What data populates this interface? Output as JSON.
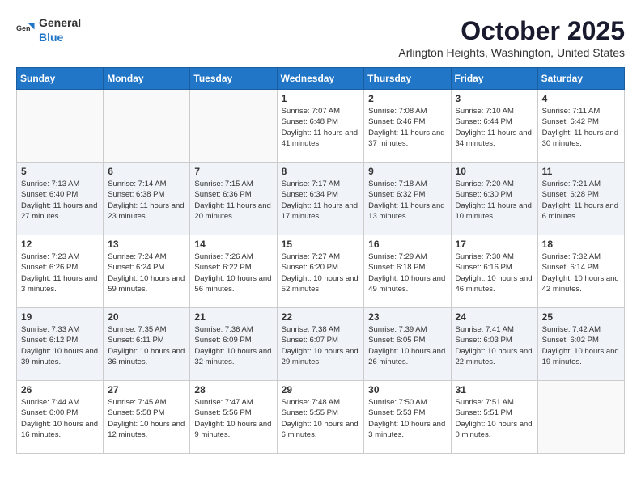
{
  "header": {
    "logo_general": "General",
    "logo_blue": "Blue",
    "month_title": "October 2025",
    "location": "Arlington Heights, Washington, United States"
  },
  "weekdays": [
    "Sunday",
    "Monday",
    "Tuesday",
    "Wednesday",
    "Thursday",
    "Friday",
    "Saturday"
  ],
  "weeks": [
    [
      {
        "day": "",
        "info": ""
      },
      {
        "day": "",
        "info": ""
      },
      {
        "day": "",
        "info": ""
      },
      {
        "day": "1",
        "info": "Sunrise: 7:07 AM\nSunset: 6:48 PM\nDaylight: 11 hours and 41 minutes."
      },
      {
        "day": "2",
        "info": "Sunrise: 7:08 AM\nSunset: 6:46 PM\nDaylight: 11 hours and 37 minutes."
      },
      {
        "day": "3",
        "info": "Sunrise: 7:10 AM\nSunset: 6:44 PM\nDaylight: 11 hours and 34 minutes."
      },
      {
        "day": "4",
        "info": "Sunrise: 7:11 AM\nSunset: 6:42 PM\nDaylight: 11 hours and 30 minutes."
      }
    ],
    [
      {
        "day": "5",
        "info": "Sunrise: 7:13 AM\nSunset: 6:40 PM\nDaylight: 11 hours and 27 minutes."
      },
      {
        "day": "6",
        "info": "Sunrise: 7:14 AM\nSunset: 6:38 PM\nDaylight: 11 hours and 23 minutes."
      },
      {
        "day": "7",
        "info": "Sunrise: 7:15 AM\nSunset: 6:36 PM\nDaylight: 11 hours and 20 minutes."
      },
      {
        "day": "8",
        "info": "Sunrise: 7:17 AM\nSunset: 6:34 PM\nDaylight: 11 hours and 17 minutes."
      },
      {
        "day": "9",
        "info": "Sunrise: 7:18 AM\nSunset: 6:32 PM\nDaylight: 11 hours and 13 minutes."
      },
      {
        "day": "10",
        "info": "Sunrise: 7:20 AM\nSunset: 6:30 PM\nDaylight: 11 hours and 10 minutes."
      },
      {
        "day": "11",
        "info": "Sunrise: 7:21 AM\nSunset: 6:28 PM\nDaylight: 11 hours and 6 minutes."
      }
    ],
    [
      {
        "day": "12",
        "info": "Sunrise: 7:23 AM\nSunset: 6:26 PM\nDaylight: 11 hours and 3 minutes."
      },
      {
        "day": "13",
        "info": "Sunrise: 7:24 AM\nSunset: 6:24 PM\nDaylight: 10 hours and 59 minutes."
      },
      {
        "day": "14",
        "info": "Sunrise: 7:26 AM\nSunset: 6:22 PM\nDaylight: 10 hours and 56 minutes."
      },
      {
        "day": "15",
        "info": "Sunrise: 7:27 AM\nSunset: 6:20 PM\nDaylight: 10 hours and 52 minutes."
      },
      {
        "day": "16",
        "info": "Sunrise: 7:29 AM\nSunset: 6:18 PM\nDaylight: 10 hours and 49 minutes."
      },
      {
        "day": "17",
        "info": "Sunrise: 7:30 AM\nSunset: 6:16 PM\nDaylight: 10 hours and 46 minutes."
      },
      {
        "day": "18",
        "info": "Sunrise: 7:32 AM\nSunset: 6:14 PM\nDaylight: 10 hours and 42 minutes."
      }
    ],
    [
      {
        "day": "19",
        "info": "Sunrise: 7:33 AM\nSunset: 6:12 PM\nDaylight: 10 hours and 39 minutes."
      },
      {
        "day": "20",
        "info": "Sunrise: 7:35 AM\nSunset: 6:11 PM\nDaylight: 10 hours and 36 minutes."
      },
      {
        "day": "21",
        "info": "Sunrise: 7:36 AM\nSunset: 6:09 PM\nDaylight: 10 hours and 32 minutes."
      },
      {
        "day": "22",
        "info": "Sunrise: 7:38 AM\nSunset: 6:07 PM\nDaylight: 10 hours and 29 minutes."
      },
      {
        "day": "23",
        "info": "Sunrise: 7:39 AM\nSunset: 6:05 PM\nDaylight: 10 hours and 26 minutes."
      },
      {
        "day": "24",
        "info": "Sunrise: 7:41 AM\nSunset: 6:03 PM\nDaylight: 10 hours and 22 minutes."
      },
      {
        "day": "25",
        "info": "Sunrise: 7:42 AM\nSunset: 6:02 PM\nDaylight: 10 hours and 19 minutes."
      }
    ],
    [
      {
        "day": "26",
        "info": "Sunrise: 7:44 AM\nSunset: 6:00 PM\nDaylight: 10 hours and 16 minutes."
      },
      {
        "day": "27",
        "info": "Sunrise: 7:45 AM\nSunset: 5:58 PM\nDaylight: 10 hours and 12 minutes."
      },
      {
        "day": "28",
        "info": "Sunrise: 7:47 AM\nSunset: 5:56 PM\nDaylight: 10 hours and 9 minutes."
      },
      {
        "day": "29",
        "info": "Sunrise: 7:48 AM\nSunset: 5:55 PM\nDaylight: 10 hours and 6 minutes."
      },
      {
        "day": "30",
        "info": "Sunrise: 7:50 AM\nSunset: 5:53 PM\nDaylight: 10 hours and 3 minutes."
      },
      {
        "day": "31",
        "info": "Sunrise: 7:51 AM\nSunset: 5:51 PM\nDaylight: 10 hours and 0 minutes."
      },
      {
        "day": "",
        "info": ""
      }
    ]
  ]
}
